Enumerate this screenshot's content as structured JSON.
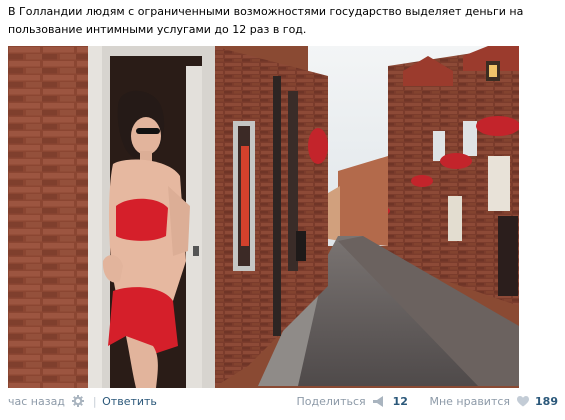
{
  "post": {
    "text": "В Голландии людям с ограниченными возможностями государство выделяет деньги на пользование интимными услугами до 12 раз в год."
  },
  "photo": {
    "alt": "photo",
    "colors": {
      "brick": "#8a4a33",
      "sky": "#e9eef1",
      "street": "#5b5656",
      "dress": "#d51f2a"
    }
  },
  "footer": {
    "time": "час назад",
    "separator": "|",
    "reply_label": "Ответить",
    "share_label": "Поделиться",
    "share_count": "12",
    "like_label": "Мне нравится",
    "like_count": "189"
  },
  "icons": {
    "gear": "gear-icon",
    "share": "megaphone-icon",
    "like": "heart-icon"
  },
  "colors": {
    "link": "#2b587a",
    "muted": "#8d9aa8"
  }
}
